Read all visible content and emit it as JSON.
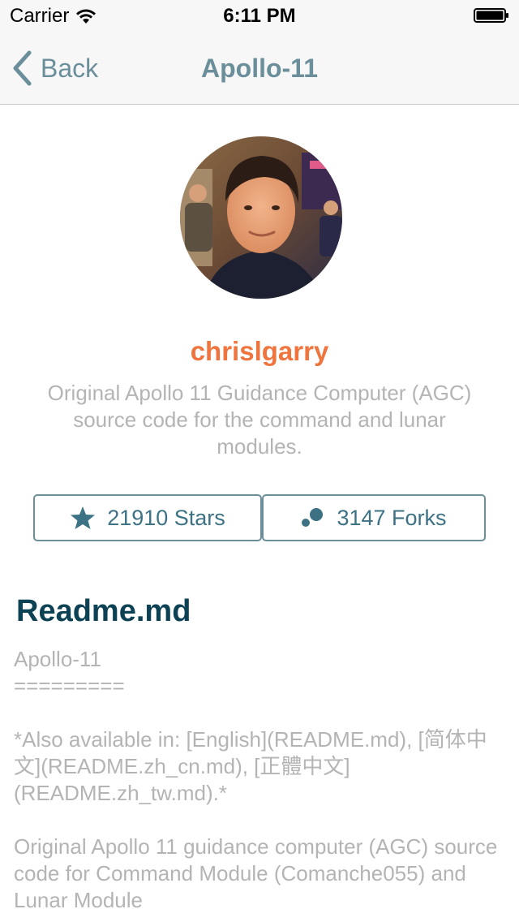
{
  "status_bar": {
    "carrier": "Carrier",
    "time": "6:11 PM"
  },
  "nav": {
    "back_label": "Back",
    "title": "Apollo-11"
  },
  "profile": {
    "username": "chrislgarry",
    "description": "Original Apollo 11 Guidance Computer (AGC) source code for the command and lunar modules."
  },
  "stats": {
    "stars_label": "21910 Stars",
    "forks_label": "3147 Forks"
  },
  "readme": {
    "title": "Readme.md",
    "heading": "Apollo-11",
    "underline": "=========",
    "also_available": "*Also available in: [English](README.md), [简体中文](README.zh_cn.md), [正體中文](README.zh_tw.md).*",
    "intro": "Original Apollo 11 guidance computer (AGC) source code for Command Module (Comanche055) and Lunar Module"
  },
  "colors": {
    "accent": "#6b8e9b",
    "username": "#f0743e",
    "readme_title": "#0d4254",
    "muted_text": "#b4b4b4"
  }
}
